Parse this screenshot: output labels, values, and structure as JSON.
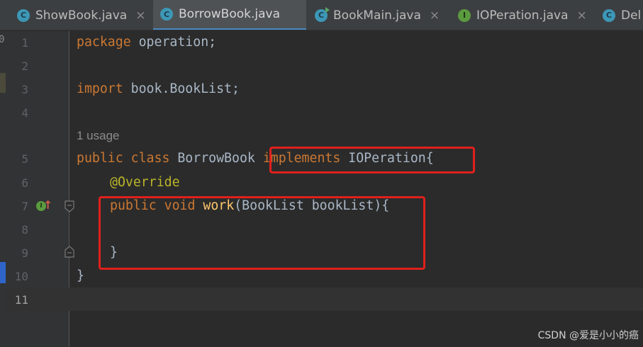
{
  "tabs": [
    {
      "label": "ShowBook.java",
      "icon": "class-file-icon",
      "icon_glyph": "C",
      "active": false
    },
    {
      "label": "BorrowBook.java",
      "icon": "class-file-icon",
      "icon_glyph": "C",
      "active": true
    },
    {
      "label": "BookMain.java",
      "icon": "main-class-file-icon",
      "icon_glyph": "C",
      "active": false
    },
    {
      "label": "IOPeration.java",
      "icon": "interface-file-icon",
      "icon_glyph": "I",
      "active": false
    },
    {
      "label": "Del",
      "icon": "class-file-icon",
      "icon_glyph": "C",
      "active": false
    }
  ],
  "tab_close_glyph": "×",
  "editor": {
    "left_strip_digit": "0",
    "line_numbers": [
      "1",
      "2",
      "3",
      "4",
      "5",
      "6",
      "7",
      "8",
      "9",
      "10",
      "11"
    ],
    "current_line": "11",
    "usage_hint": "1 usage",
    "code": {
      "l1_kw": "package",
      "l1_rest": " operation;",
      "l3_kw": "import",
      "l3_rest": " book.BookList;",
      "l5_kw": "public class",
      "l5_name": " BorrowBook ",
      "l5_kw2": "implements",
      "l5_rest": " IOPeration{",
      "l6_ann": "@Override",
      "l7_kw": "public void",
      "l7_fn": "work",
      "l7_rest": "(BookList bookList){",
      "l9_brace": "}",
      "l10_brace": "}"
    },
    "gutter_icons": {
      "implements_icon_glyph": "I",
      "up_arrow_glyph": "↑"
    },
    "highlight_color": "#e0201c"
  },
  "watermark": "CSDN @爱是小小的癌",
  "colors": {
    "keyword": "#cc7832",
    "annotation": "#bbb529",
    "function": "#ffc66d",
    "text": "#a9b7c6",
    "active_tab_underline": "#4a88c7"
  }
}
